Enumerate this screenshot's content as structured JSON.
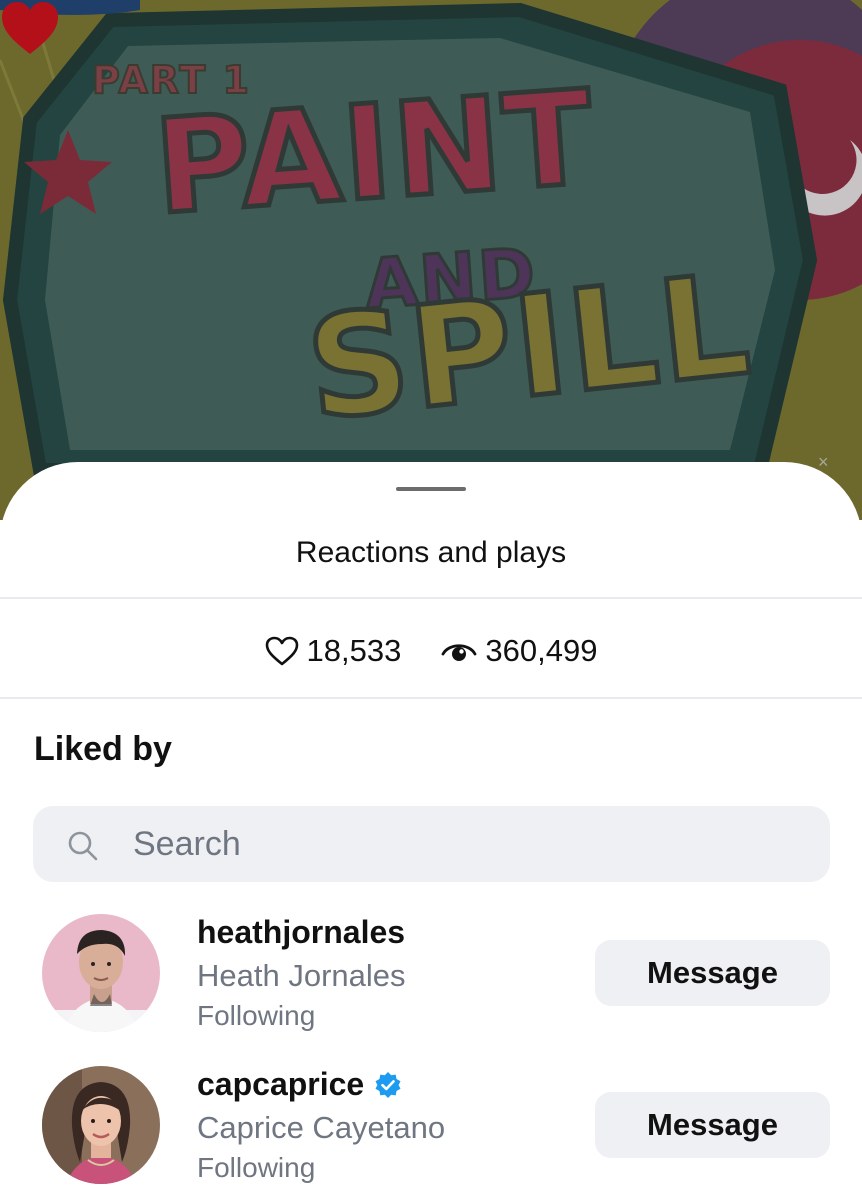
{
  "background": {
    "artwork_lines": [
      "PART 1",
      "PAINT",
      "AND",
      "SPILL"
    ],
    "like_heart_icon": "heart-filled-icon",
    "like_heart_color": "#b3101a",
    "close_glyph": "×"
  },
  "sheet": {
    "title": "Reactions and plays",
    "stats": {
      "likes": "18,533",
      "likes_icon": "heart-outline-icon",
      "plays": "360,499",
      "plays_icon": "eye-icon"
    },
    "liked_by_title": "Liked by",
    "search": {
      "placeholder": "Search",
      "value": "",
      "icon": "search-icon"
    },
    "users": [
      {
        "username": "heathjornales",
        "full_name": "Heath Jornales",
        "status": "Following",
        "verified": false,
        "button_label": "Message"
      },
      {
        "username": "capcaprice",
        "full_name": "Caprice Cayetano",
        "status": "Following",
        "verified": true,
        "button_label": "Message"
      }
    ]
  },
  "colors": {
    "text_primary": "#111111",
    "text_secondary": "#6f7681",
    "button_bg": "#eff0f4",
    "verified_blue": "#1d9bf0"
  }
}
